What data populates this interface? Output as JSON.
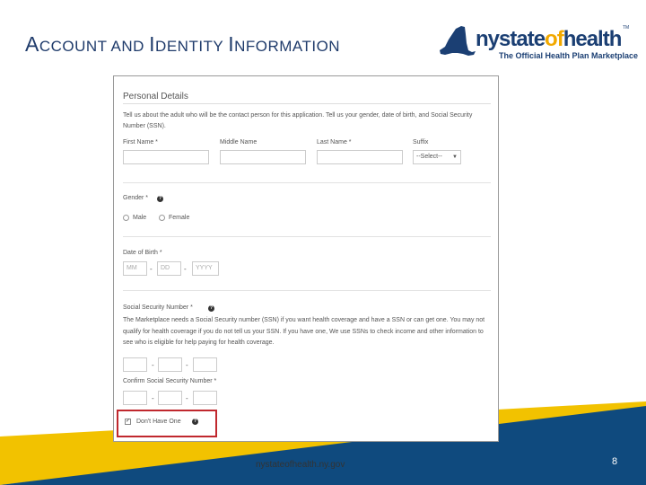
{
  "slide": {
    "title_part1_cap": "A",
    "title_part1_rest": "CCOUNT AND ",
    "title_part2_cap": "I",
    "title_part2_rest": "DENTITY ",
    "title_part3_cap": "I",
    "title_part3_rest": "NFORMATION",
    "footer_url": "nystateofhealth.ny.gov",
    "page_number": "8"
  },
  "logo": {
    "word_ny": "nystate",
    "word_of": "of",
    "word_health": "health",
    "tagline": "The Official Health Plan Marketplace",
    "trademark": "TM"
  },
  "form": {
    "section_title": "Personal Details",
    "intro": "Tell us about the adult who will be the contact person for this application. Tell us your gender, date of birth, and Social Security Number (SSN).",
    "first_name_label": "First Name *",
    "middle_name_label": "Middle Name",
    "last_name_label": "Last Name *",
    "suffix_label": "Suffix",
    "suffix_value": "--Select--",
    "gender_label": "Gender *",
    "gender_options": [
      "Male",
      "Female"
    ],
    "dob_label": "Date of Birth *",
    "dob_placeholders": {
      "month": "MM",
      "day": "DD",
      "year": "YYYY"
    },
    "dash": "-",
    "ssn_label": "Social Security Number *",
    "ssn_para": "The Marketplace needs a Social Security number (SSN) if you want health coverage and have a SSN or can get one. You may not qualify for health coverage if you do not tell us your SSN. If you have one, We use SSNs to check income and other information to see who is eligible for help paying for health coverage.",
    "confirm_ssn_label": "Confirm Social Security Number *",
    "dont_have_label": "Don't Have One",
    "check_mark": "✓",
    "help_glyph": "?"
  },
  "colors": {
    "title": "#1f3b6b",
    "navy": "#0f4a7e",
    "gold": "#f2c200",
    "highlight": "#c0282e"
  }
}
